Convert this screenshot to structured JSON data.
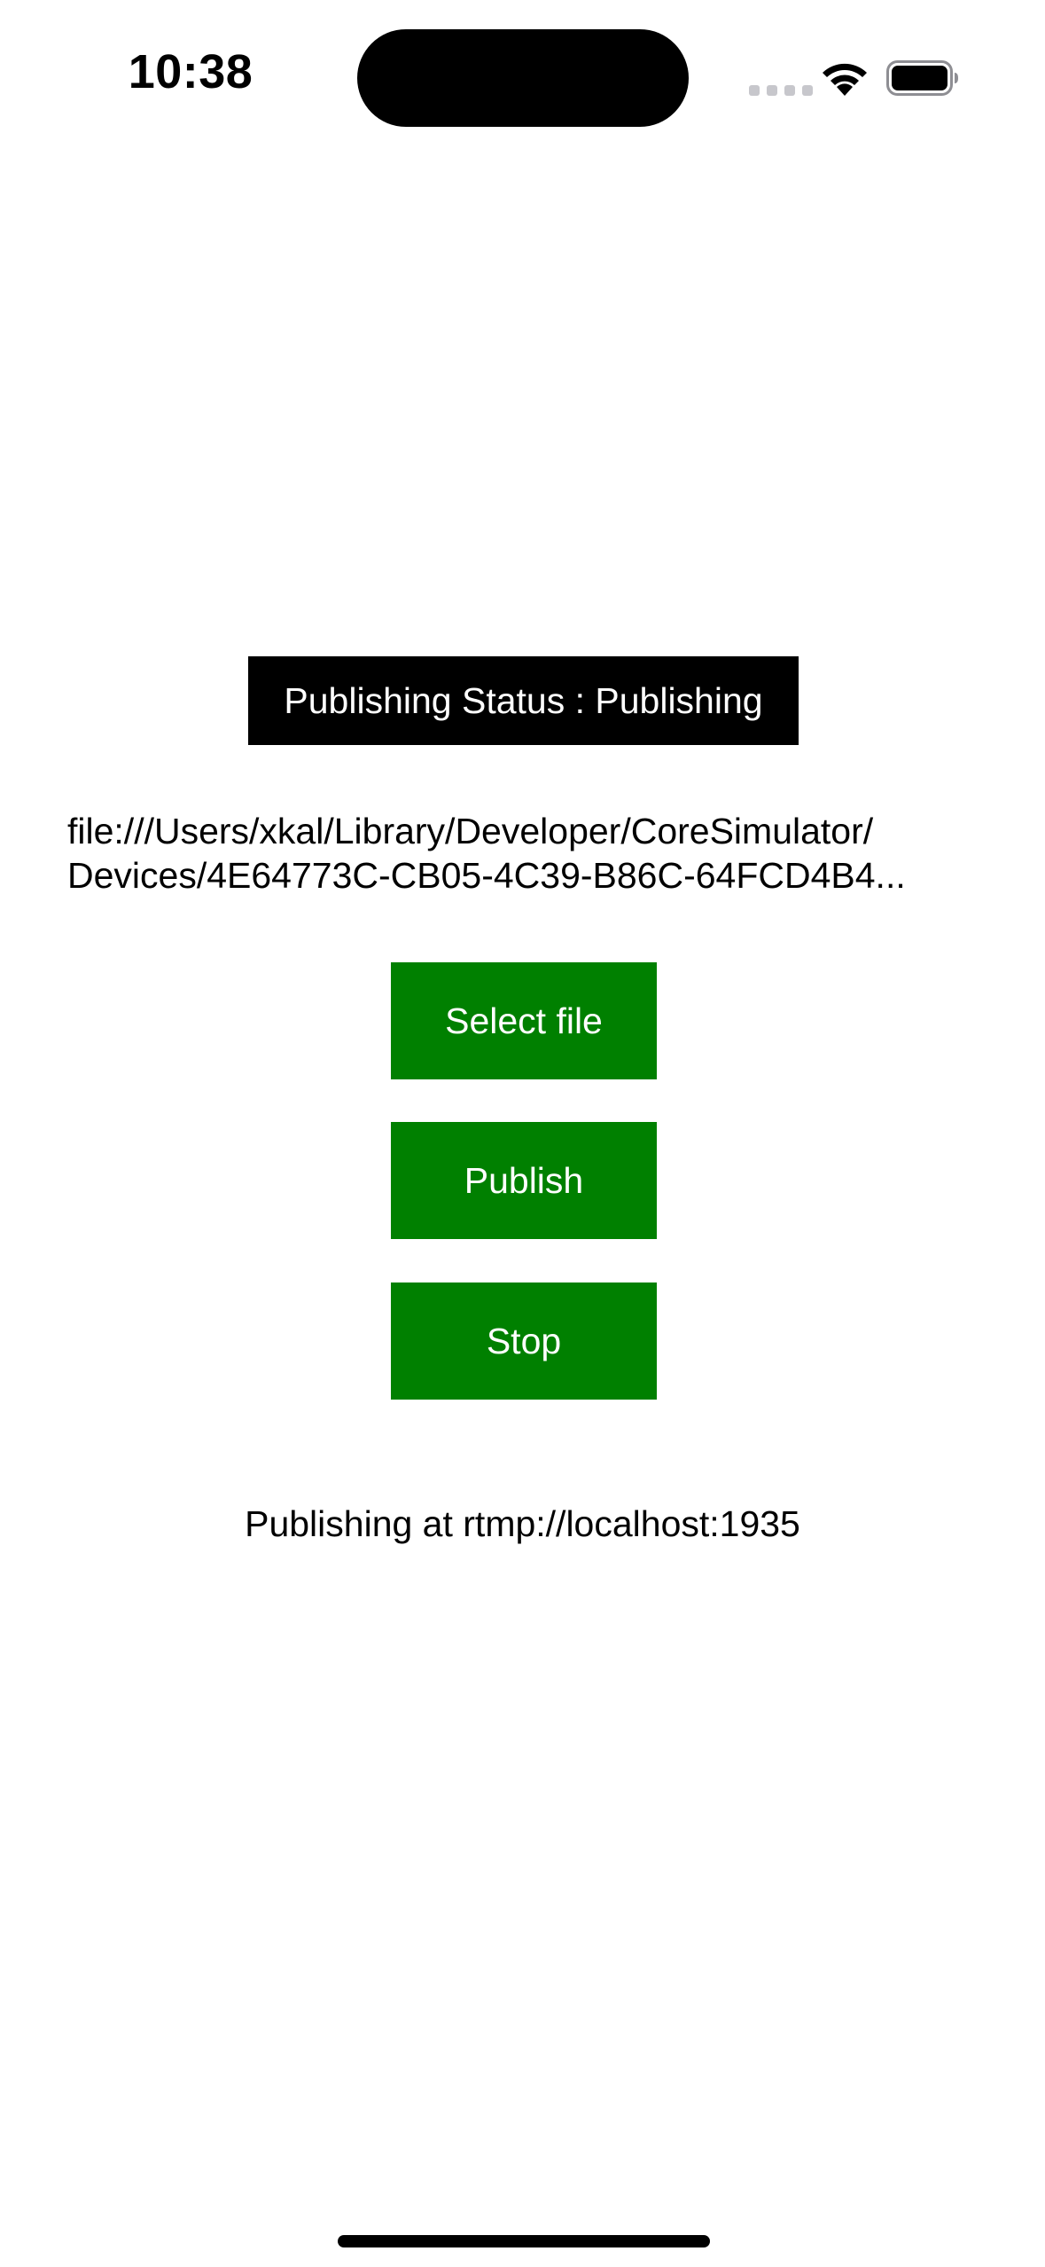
{
  "status_bar": {
    "time": "10:38",
    "icons": [
      "cellular-signal-icon",
      "wifi-icon",
      "battery-icon"
    ]
  },
  "main": {
    "publishing_status": "Publishing Status : Publishing",
    "file_path_line1": "file:///Users/xkal/Library/Developer/CoreSimulator/",
    "file_path_line2": "Devices/4E64773C-CB05-4C39-B86C-64FCD4B4...",
    "buttons": {
      "select_file": "Select file",
      "publish": "Publish",
      "stop": "Stop"
    },
    "publishing_url": "Publishing at rtmp://localhost:1935"
  },
  "colors": {
    "button_background": "#008000",
    "button_text": "#ffffff",
    "status_banner_background": "#000000",
    "status_banner_text": "#ffffff",
    "page_background": "#ffffff"
  }
}
